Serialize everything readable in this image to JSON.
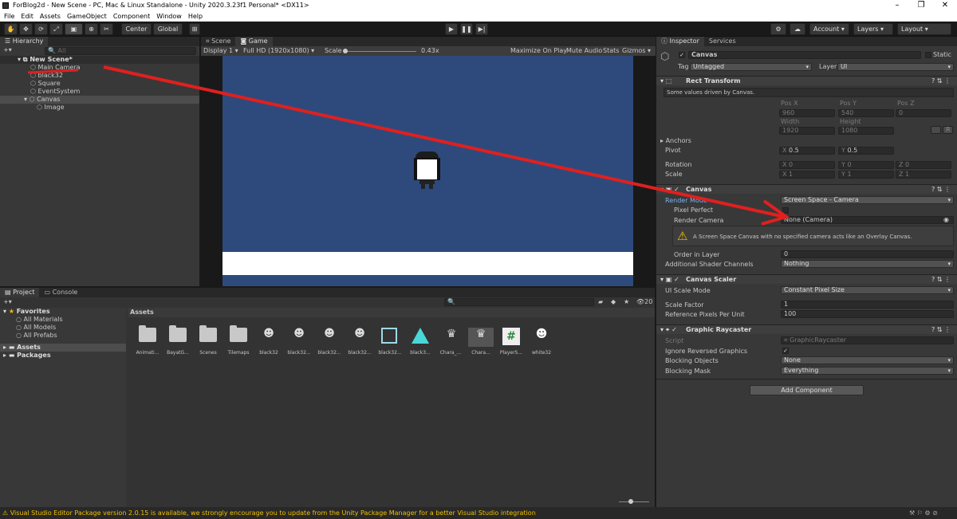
{
  "title": "ForBlog2d - New Scene - PC, Mac & Linux Standalone - Unity 2020.3.23f1 Personal* <DX11>",
  "menu": [
    "File",
    "Edit",
    "Assets",
    "GameObject",
    "Component",
    "Window",
    "Help"
  ],
  "toolbar": {
    "center": "Center",
    "global": "Global",
    "account": "Account",
    "layers": "Layers",
    "layout": "Layout"
  },
  "hierarchy": {
    "tab": "Hierarchy",
    "search_placeholder": "All",
    "scene": "New Scene*",
    "items": [
      "Main Camera",
      "black32",
      "Square",
      "EventSystem",
      "Canvas",
      "Image"
    ]
  },
  "view_tabs": {
    "scene": "Scene",
    "game": "Game"
  },
  "game_bar": {
    "display": "Display 1",
    "resolution": "Full HD (1920x1080)",
    "scale_label": "Scale",
    "scale_value": "0.43x",
    "maximize": "Maximize On Play",
    "mute": "Mute Audio",
    "stats": "Stats",
    "gizmos": "Gizmos"
  },
  "project": {
    "tabs": [
      "Project",
      "Console"
    ],
    "favorites": "Favorites",
    "fav_items": [
      "All Materials",
      "All Models",
      "All Prefabs"
    ],
    "roots": [
      "Assets",
      "Packages"
    ],
    "assets_header": "Assets",
    "count": "20",
    "assets": [
      "Animati...",
      "BayatG...",
      "Scenes",
      "Tilemaps",
      "black32",
      "black32...",
      "black32...",
      "black32...",
      "black32...",
      "black3...",
      "Chara_...",
      "Chara...",
      "PlayerS...",
      "white32"
    ]
  },
  "inspector": {
    "tabs": [
      "Inspector",
      "Services"
    ],
    "object": "Canvas",
    "static": "Static",
    "tag_label": "Tag",
    "tag": "Untagged",
    "layer_label": "Layer",
    "layer": "UI",
    "rect": {
      "title": "Rect Transform",
      "note": "Some values driven by Canvas.",
      "posx_l": "Pos X",
      "posy_l": "Pos Y",
      "posz_l": "Pos Z",
      "posx": "960",
      "posy": "540",
      "posz": "0",
      "w_l": "Width",
      "h_l": "Height",
      "w": "1920",
      "h": "1080",
      "r": "R",
      "anchors": "Anchors",
      "pivot": "Pivot",
      "pivot_x": "0.5",
      "pivot_y": "0.5",
      "rotation": "Rotation",
      "rot_x": "0",
      "rot_y": "0",
      "rot_z": "0",
      "scale": "Scale",
      "sc_x": "1",
      "sc_y": "1",
      "sc_z": "1"
    },
    "canvas": {
      "title": "Canvas",
      "render_mode_l": "Render Mode",
      "render_mode": "Screen Space - Camera",
      "pixel_perfect": "Pixel Perfect",
      "render_camera_l": "Render Camera",
      "render_camera": "None (Camera)",
      "warning": "A Screen Space Canvas with no specified camera acts like an Overlay Canvas.",
      "order_l": "Order in Layer",
      "order": "0",
      "shader_l": "Additional Shader Channels",
      "shader": "Nothing"
    },
    "scaler": {
      "title": "Canvas Scaler",
      "mode_l": "UI Scale Mode",
      "mode": "Constant Pixel Size",
      "factor_l": "Scale Factor",
      "factor": "1",
      "ref_l": "Reference Pixels Per Unit",
      "ref": "100"
    },
    "raycaster": {
      "title": "Graphic Raycaster",
      "script_l": "Script",
      "script": "GraphicRaycaster",
      "ignore_l": "Ignore Reversed Graphics",
      "block_obj_l": "Blocking Objects",
      "block_obj": "None",
      "block_mask_l": "Blocking Mask",
      "block_mask": "Everything"
    },
    "add_component": "Add Component"
  },
  "status": "Visual Studio Editor Package version 2.0.15 is available, we strongly encourage you to update from the Unity Package Manager for a better Visual Studio integration",
  "colors": {
    "game_bg": "#2e4a7c",
    "arrow": "#e0201f",
    "selection": "#2c5d87",
    "warning": "#f0c000"
  }
}
